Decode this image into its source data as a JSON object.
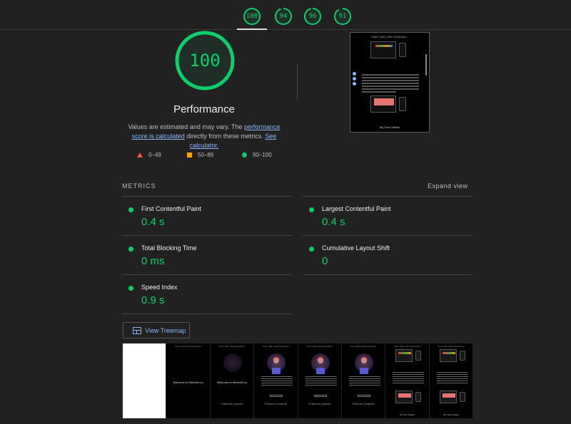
{
  "top_scores": [
    {
      "value": "100"
    },
    {
      "value": "94"
    },
    {
      "value": "96"
    },
    {
      "value": "91"
    }
  ],
  "gauge": {
    "value": "100",
    "title": "Performance"
  },
  "description": {
    "prefix": "Values are estimated and may vary. The ",
    "link1": "performance score is calculated",
    "middle": " directly from these metrics. ",
    "link2": "See calculator."
  },
  "legend": [
    {
      "range": "0–49",
      "color": "#ff4e42",
      "shape": "triangle"
    },
    {
      "range": "50–89",
      "color": "#ffa400",
      "shape": "square"
    },
    {
      "range": "90–100",
      "color": "#0cce6b",
      "shape": "circle"
    }
  ],
  "metrics_section": {
    "label": "METRICS",
    "expand": "Expand view"
  },
  "metrics": [
    {
      "name": "First Contentful Paint",
      "value": "0.4 s"
    },
    {
      "name": "Largest Contentful Paint",
      "value": "0.4 s"
    },
    {
      "name": "Total Blocking Time",
      "value": "0 ms"
    },
    {
      "name": "Cumulative Layout Shift",
      "value": "0"
    },
    {
      "name": "Speed Index",
      "value": "0.9 s"
    }
  ],
  "treemap_button": "View Treemap",
  "thumbnail": {
    "header": "Umer Sahl | Web Developer",
    "footer": "My Tech Stacks"
  },
  "filmstrip": {
    "welcome": "Welcome to MeerAhl.co",
    "featured": "Featured projects",
    "footer": "My Tech Stacks"
  },
  "colors": {
    "pass": "#0cce6b",
    "link": "#8ab4f8",
    "background": "#212121"
  }
}
